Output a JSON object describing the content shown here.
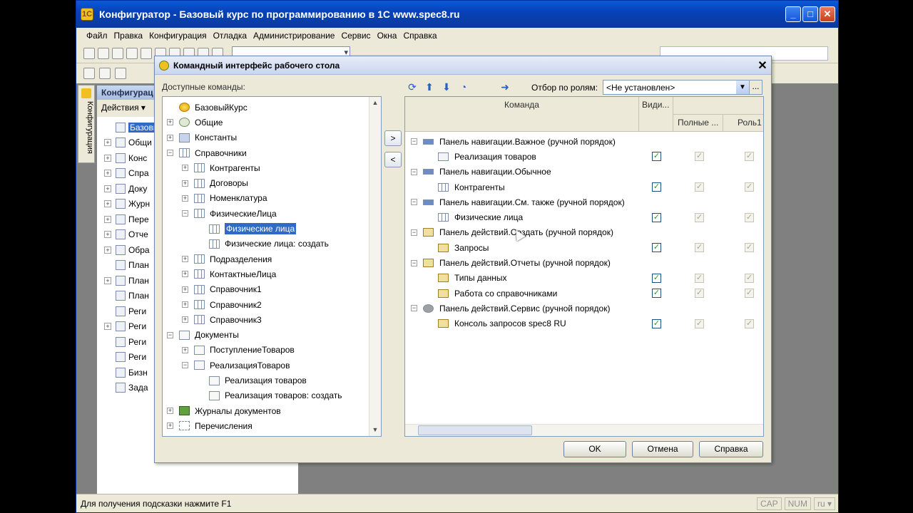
{
  "window": {
    "title": "Конфигуратор - Базовый курс по программированию в 1С www.spec8.ru",
    "controls": [
      "_",
      "□",
      "✕"
    ]
  },
  "menu": [
    "Файл",
    "Правка",
    "Конфигурация",
    "Отладка",
    "Администрирование",
    "Сервис",
    "Окна",
    "Справка"
  ],
  "left_panel": {
    "tab_label": "Конфигурация",
    "header": "Конфигурац",
    "actions_label": "Действия ▾",
    "items": [
      {
        "label": "Базовый",
        "selected": true,
        "expand": ""
      },
      {
        "label": "Общи",
        "expand": "+"
      },
      {
        "label": "Конс",
        "expand": "+"
      },
      {
        "label": "Спра",
        "expand": "+"
      },
      {
        "label": "Доку",
        "expand": "+"
      },
      {
        "label": "Журн",
        "expand": "+"
      },
      {
        "label": "Пере",
        "expand": "+"
      },
      {
        "label": "Отче",
        "expand": "+"
      },
      {
        "label": "Обра",
        "expand": "+"
      },
      {
        "label": "План",
        "expand": ""
      },
      {
        "label": "План",
        "expand": "+"
      },
      {
        "label": "План",
        "expand": ""
      },
      {
        "label": "Реги",
        "expand": ""
      },
      {
        "label": "Реги",
        "expand": "+"
      },
      {
        "label": "Реги",
        "expand": ""
      },
      {
        "label": "Реги",
        "expand": ""
      },
      {
        "label": "Бизн",
        "expand": ""
      },
      {
        "label": "Зада",
        "expand": ""
      }
    ]
  },
  "status": {
    "hint": "Для получения подсказки нажмите F1",
    "cap": "CAP",
    "num": "NUM",
    "lang": "ru ▾"
  },
  "dialog": {
    "title": "Командный интерфейс рабочего стола",
    "close": "✕",
    "available_label": "Доступные команды:",
    "tree": [
      {
        "label": "БазовыйКурс",
        "level": 0,
        "expand": "",
        "icon": "yellow"
      },
      {
        "label": "Общие",
        "level": 0,
        "expand": "+",
        "icon": "multi"
      },
      {
        "label": "Константы",
        "level": 0,
        "expand": "+",
        "icon": "const"
      },
      {
        "label": "Справочники",
        "level": 0,
        "expand": "−",
        "icon": "ref"
      },
      {
        "label": "Контрагенты",
        "level": 1,
        "expand": "+",
        "icon": "ref"
      },
      {
        "label": "Договоры",
        "level": 1,
        "expand": "+",
        "icon": "ref"
      },
      {
        "label": "Номенклатура",
        "level": 1,
        "expand": "+",
        "icon": "ref"
      },
      {
        "label": "ФизическиеЛица",
        "level": 1,
        "expand": "−",
        "icon": "ref"
      },
      {
        "label": "Физические лица",
        "level": 2,
        "expand": "",
        "icon": "ref",
        "selected": true
      },
      {
        "label": "Физические лица: создать",
        "level": 2,
        "expand": "",
        "icon": "ref"
      },
      {
        "label": "Подразделения",
        "level": 1,
        "expand": "+",
        "icon": "ref"
      },
      {
        "label": "КонтактныеЛица",
        "level": 1,
        "expand": "+",
        "icon": "ref"
      },
      {
        "label": "Справочник1",
        "level": 1,
        "expand": "+",
        "icon": "ref"
      },
      {
        "label": "Справочник2",
        "level": 1,
        "expand": "+",
        "icon": "ref"
      },
      {
        "label": "Справочник3",
        "level": 1,
        "expand": "+",
        "icon": "ref"
      },
      {
        "label": "Документы",
        "level": 0,
        "expand": "−",
        "icon": "doc"
      },
      {
        "label": "ПоступлениеТоваров",
        "level": 1,
        "expand": "+",
        "icon": "doc"
      },
      {
        "label": "РеализацияТоваров",
        "level": 1,
        "expand": "−",
        "icon": "doc"
      },
      {
        "label": "Реализация товаров",
        "level": 2,
        "expand": "",
        "icon": "doc"
      },
      {
        "label": "Реализация товаров: создать",
        "level": 2,
        "expand": "",
        "icon": "doc"
      },
      {
        "label": "Журналы документов",
        "level": 0,
        "expand": "+",
        "icon": "journal"
      },
      {
        "label": "Перечисления",
        "level": 0,
        "expand": "+",
        "icon": "enum"
      }
    ],
    "move_right": ">",
    "move_left": "<",
    "role_filter_label": "Отбор по ролям:",
    "role_filter_value": "<Не установлен>",
    "role_filter_more": "...",
    "columns": {
      "command": "Команда",
      "visible": "Види...",
      "full": "Полные ...",
      "role1": "Роль1"
    },
    "commands": [
      {
        "label": "Панель навигации.Важное (ручной порядок)",
        "group": true,
        "icon": "panel"
      },
      {
        "label": "Реализация товаров",
        "group": false,
        "icon": "doc",
        "visible": true,
        "full": true,
        "role1": true
      },
      {
        "label": "Панель навигации.Обычное",
        "group": true,
        "icon": "panel"
      },
      {
        "label": "Контрагенты",
        "group": false,
        "icon": "ref",
        "visible": true,
        "full": true,
        "role1": true
      },
      {
        "label": "Панель навигации.См. также (ручной порядок)",
        "group": true,
        "icon": "panel"
      },
      {
        "label": "Физические лица",
        "group": false,
        "icon": "ref",
        "visible": true,
        "full": true,
        "role1": true
      },
      {
        "label": "Панель действий.Создать (ручной порядок)",
        "group": true,
        "icon": "cmd"
      },
      {
        "label": "Запросы",
        "group": false,
        "icon": "cmd",
        "visible": true,
        "full": true,
        "role1": true
      },
      {
        "label": "Панель действий.Отчеты (ручной порядок)",
        "group": true,
        "icon": "cmd"
      },
      {
        "label": "Типы данных",
        "group": false,
        "icon": "cmd",
        "visible": true,
        "full": true,
        "role1": true
      },
      {
        "label": "Работа со справочниками",
        "group": false,
        "icon": "cmd",
        "visible": true,
        "full": true,
        "role1": true
      },
      {
        "label": "Панель действий.Сервис (ручной порядок)",
        "group": true,
        "icon": "gear"
      },
      {
        "label": "Консоль запросов spec8 RU",
        "group": false,
        "icon": "cmd",
        "visible": true,
        "full": true,
        "role1": true
      }
    ],
    "buttons": {
      "ok": "OK",
      "cancel": "Отмена",
      "help": "Справка"
    }
  }
}
